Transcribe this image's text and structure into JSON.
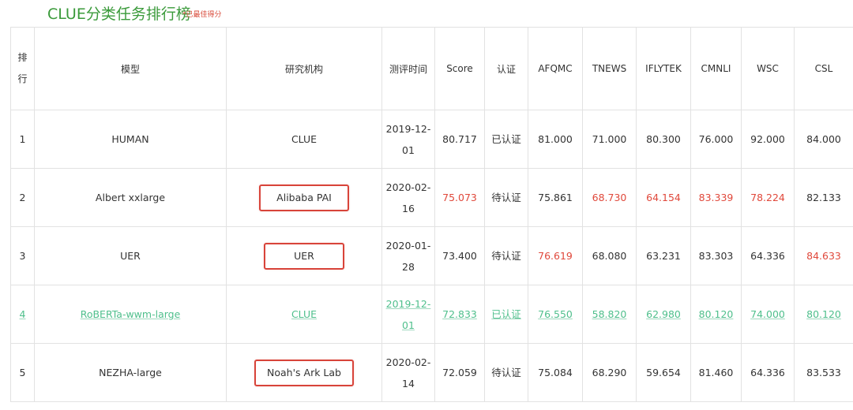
{
  "page": {
    "title": "CLUE分类任务排行榜",
    "subnote": "*已最佳得分"
  },
  "table": {
    "headers": {
      "rank": "排行",
      "model": "模型",
      "org": "研究机构",
      "time": "测评时间",
      "score": "Score",
      "cert": "认证",
      "afqmc": "AFQMC",
      "tnews": "TNEWS",
      "iflytek": "IFLYTEK",
      "cmnli": "CMNLI",
      "wsc": "WSC",
      "csl": "CSL"
    },
    "rows": [
      {
        "rank": "1",
        "model": "HUMAN",
        "org": "CLUE",
        "time1": "2019-12-",
        "time2": "01",
        "score": "80.717",
        "cert": "已认证",
        "afqmc": "81.000",
        "tnews": "71.000",
        "iflytek": "80.300",
        "cmnli": "76.000",
        "wsc": "92.000",
        "csl": "84.000"
      },
      {
        "rank": "2",
        "model": "Albert xxlarge",
        "org": "Alibaba PAI",
        "time1": "2020-02-",
        "time2": "16",
        "score": "75.073",
        "cert": "待认证",
        "afqmc": "75.861",
        "tnews": "68.730",
        "iflytek": "64.154",
        "cmnli": "83.339",
        "wsc": "78.224",
        "csl": "82.133"
      },
      {
        "rank": "3",
        "model": "UER",
        "org": "UER",
        "time1": "2020-01-",
        "time2": "28",
        "score": "73.400",
        "cert": "待认证",
        "afqmc": "76.619",
        "tnews": "68.080",
        "iflytek": "63.231",
        "cmnli": "83.303",
        "wsc": "64.336",
        "csl": "84.633"
      },
      {
        "rank": "4",
        "model": "RoBERTa-wwm-large",
        "org": "CLUE",
        "time1": "2019-12-",
        "time2": "01",
        "score": "72.833",
        "cert": "已认证",
        "afqmc": "76.550",
        "tnews": "58.820",
        "iflytek": "62.980",
        "cmnli": "80.120",
        "wsc": "74.000",
        "csl": "80.120"
      },
      {
        "rank": "5",
        "model": "NEZHA-large",
        "org": "Noah's Ark Lab",
        "time1": "2020-02-",
        "time2": "14",
        "score": "72.059",
        "cert": "待认证",
        "afqmc": "75.084",
        "tnews": "68.290",
        "iflytek": "59.654",
        "cmnli": "81.460",
        "wsc": "64.336",
        "csl": "83.533"
      }
    ]
  },
  "colors": {
    "title": "#3a9a3a",
    "best_score_red": "#e0483b",
    "highlight_row": "#4fbf8c",
    "annotation_box": "#d8443a"
  }
}
